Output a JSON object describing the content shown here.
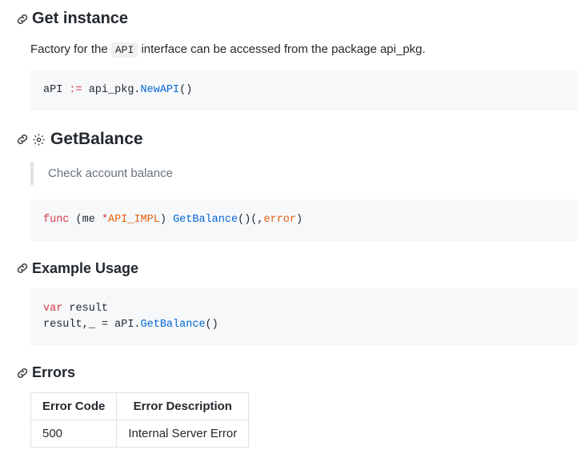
{
  "sections": {
    "getInstance": {
      "title": "Get instance",
      "para_before": "Factory for the ",
      "inline_code": "API",
      "para_after": " interface can be accessed from the package api_pkg.",
      "code": {
        "t1": "aPI ",
        "op": ":=",
        "t2": " api_pkg.",
        "fn": "NewAPI",
        "t3": "()"
      }
    },
    "getBalance": {
      "title": "GetBalance",
      "quote": "Check account balance",
      "code": {
        "kw": "func",
        "t1": " ",
        "p1": "(",
        "t2": "me ",
        "star": "*",
        "type": "API_IMPL",
        "p2": ")",
        "t3": " ",
        "fn": "GetBalance",
        "t4": "()(,",
        "err": "error",
        "p3": ")"
      }
    },
    "exampleUsage": {
      "title": "Example Usage",
      "code": {
        "kw": "var",
        "t1": " result ",
        "line2a": "result,_ = aPI.",
        "fn": "GetBalance",
        "t2": "()"
      }
    },
    "errors": {
      "title": "Errors",
      "headers": {
        "code": "Error Code",
        "desc": "Error Description"
      },
      "rows": [
        {
          "code": "500",
          "desc": "Internal Server Error"
        }
      ]
    }
  }
}
